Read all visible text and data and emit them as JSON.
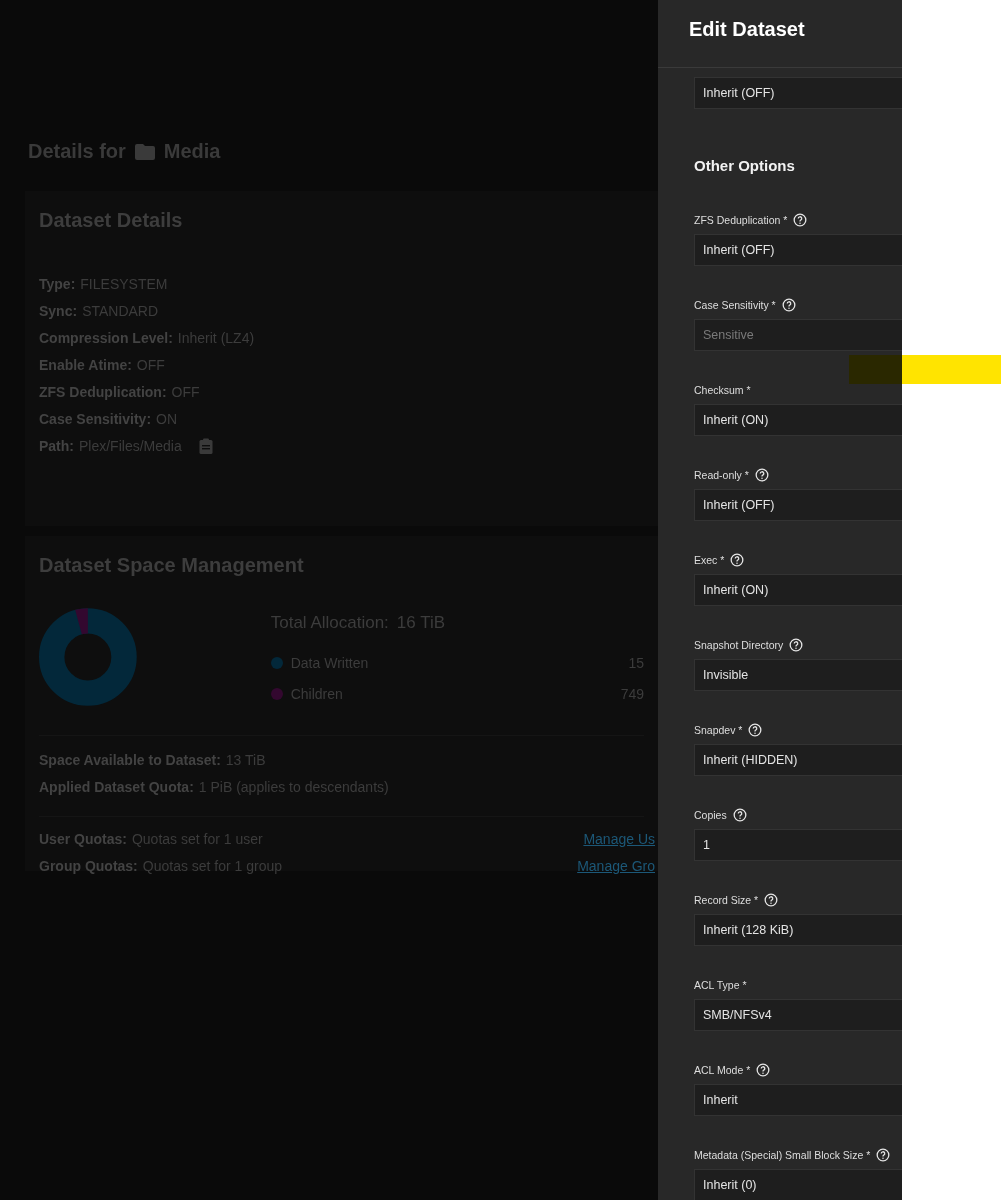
{
  "page": {
    "title_prefix": "Details for",
    "title_name": "Media"
  },
  "dataset_details": {
    "title": "Dataset Details",
    "rows": [
      {
        "label": "Type:",
        "value": "FILESYSTEM"
      },
      {
        "label": "Sync:",
        "value": "STANDARD"
      },
      {
        "label": "Compression Level:",
        "value": "Inherit (LZ4)"
      },
      {
        "label": "Enable Atime:",
        "value": "OFF"
      },
      {
        "label": "ZFS Deduplication:",
        "value": "OFF"
      },
      {
        "label": "Case Sensitivity:",
        "value": "ON"
      },
      {
        "label": "Path:",
        "value": "Plex/Files/Media",
        "copy": true
      }
    ]
  },
  "space_management": {
    "title": "Dataset Space Management",
    "total_label": "Total Allocation:",
    "total_value": "16 TiB",
    "legend": [
      {
        "name": "Data Written",
        "value": "15",
        "color": "#03283a"
      },
      {
        "name": "Children",
        "value": "749",
        "color": "#33082f"
      }
    ],
    "space_rows": [
      {
        "label": "Space Available to Dataset:",
        "value": "13 TiB"
      },
      {
        "label": "Applied Dataset Quota:",
        "value": "1 PiB (applies to descendants)"
      }
    ],
    "quota_rows": [
      {
        "label": "User Quotas:",
        "value": "Quotas set for 1 user",
        "link": "Manage Us"
      },
      {
        "label": "Group Quotas:",
        "value": "Quotas set for 1 group",
        "link": "Manage Gro"
      }
    ]
  },
  "edit_panel": {
    "title": "Edit Dataset",
    "fields": [
      {
        "kind": "select",
        "value": "Inherit (OFF)",
        "disabled": false
      },
      {
        "kind": "heading",
        "label": "Other Options"
      },
      {
        "kind": "select",
        "label": "ZFS Deduplication *",
        "help": true,
        "value": "Inherit (OFF)",
        "disabled": false
      },
      {
        "kind": "select",
        "label": "Case Sensitivity *",
        "help": true,
        "value": "Sensitive",
        "disabled": true
      },
      {
        "kind": "select",
        "label": "Checksum *",
        "help": false,
        "value": "Inherit (ON)",
        "disabled": false
      },
      {
        "kind": "select",
        "label": "Read-only *",
        "help": true,
        "value": "Inherit (OFF)",
        "disabled": false
      },
      {
        "kind": "select",
        "label": "Exec *",
        "help": true,
        "value": "Inherit (ON)",
        "disabled": false
      },
      {
        "kind": "select",
        "label": "Snapshot Directory",
        "help": true,
        "value": "Invisible",
        "disabled": false
      },
      {
        "kind": "select",
        "label": "Snapdev *",
        "help": true,
        "value": "Inherit (HIDDEN)",
        "disabled": false
      },
      {
        "kind": "input",
        "label": "Copies",
        "help": true,
        "value": "1",
        "disabled": false
      },
      {
        "kind": "select",
        "label": "Record Size *",
        "help": true,
        "value": "Inherit (128 KiB)",
        "disabled": false
      },
      {
        "kind": "select",
        "label": "ACL Type *",
        "help": false,
        "value": "SMB/NFSv4",
        "disabled": false
      },
      {
        "kind": "select",
        "label": "ACL Mode *",
        "help": true,
        "value": "Inherit",
        "disabled": false
      },
      {
        "kind": "select",
        "label": "Metadata (Special) Small Block Size *",
        "help": true,
        "value": "Inherit (0)",
        "disabled": false
      }
    ]
  }
}
